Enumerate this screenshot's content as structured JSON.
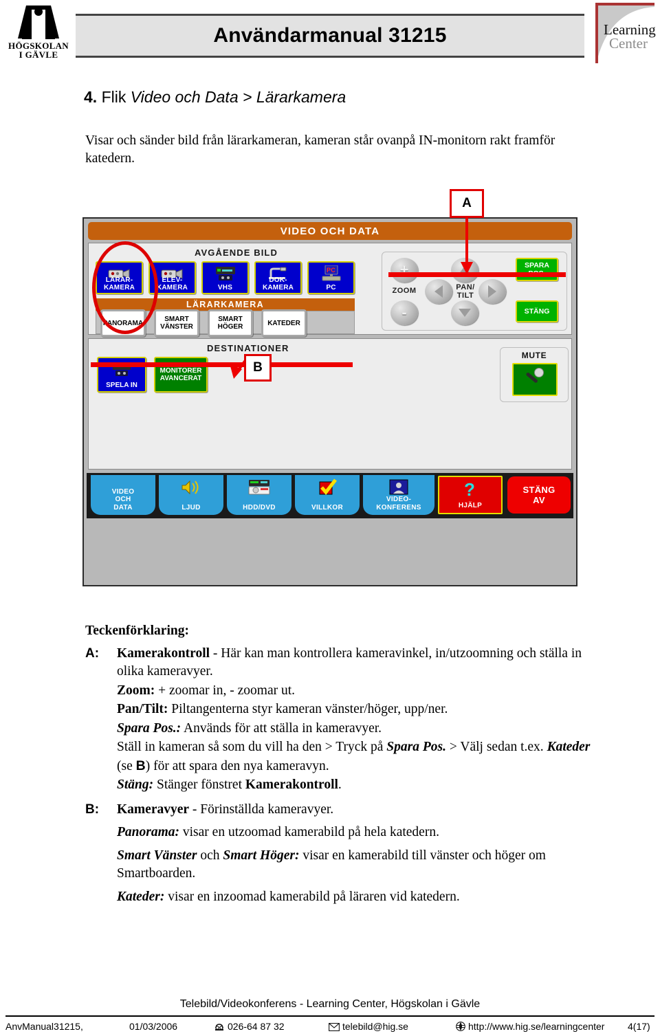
{
  "header": {
    "title": "Användarmanual 31215",
    "left_logo": {
      "name": "hogskolan-i-gavle-logo",
      "line1": "HÖGSKOLAN",
      "line2": "I GÄVLE"
    },
    "right_logo": {
      "name": "learning-center-logo",
      "line1": "Learning",
      "line2": "Center"
    }
  },
  "section": {
    "number": "4.",
    "prefix": "Flik",
    "italic_title": "Video och Data > Lärarkamera",
    "intro": "Visar och sänder bild från lärarkameran, kameran står ovanpå IN-monitorn rakt framför katedern."
  },
  "panel": {
    "title": "VIDEO OCH DATA",
    "outgoing_label": "AVGÅENDE BILD",
    "sources": [
      {
        "label_line1": "LÄRAR-",
        "label_line2": "KAMERA",
        "icon": "camcorder-icon",
        "selected": true
      },
      {
        "label_line1": "ELEV-",
        "label_line2": "KAMERA",
        "icon": "camcorder-icon",
        "selected": false
      },
      {
        "label_line1": "VHS",
        "label_line2": "",
        "icon": "vcr-icon",
        "selected": false
      },
      {
        "label_line1": "DOK-",
        "label_line2": "KAMERA",
        "icon": "document-camera-icon",
        "selected": false
      },
      {
        "label_line1": "PC",
        "label_line2": "",
        "icon": "pc-monitor-icon",
        "selected": false
      }
    ],
    "preset_group_title": "LÄRARKAMERA",
    "presets": [
      {
        "line1": "PANORAMA",
        "line2": ""
      },
      {
        "line1": "SMART",
        "line2": "VÄNSTER"
      },
      {
        "line1": "SMART",
        "line2": "HÖGER"
      },
      {
        "line1": "KATEDER",
        "line2": ""
      }
    ],
    "camera_control": {
      "zoom_label": "ZOOM",
      "zoom_in": "+",
      "zoom_out": "-",
      "pantilt_label_line1": "PAN/",
      "pantilt_label_line2": "TILT",
      "arrow_up": "arrow-up-icon",
      "arrow_down": "arrow-down-icon",
      "arrow_left": "arrow-left-icon",
      "arrow_right": "arrow-right-icon",
      "save_pos_line1": "SPARA",
      "save_pos_line2": "POS.",
      "close_label": "STÄNG"
    },
    "destinations_label": "DESTINATIONER",
    "destinations": [
      {
        "label": "SPELA IN",
        "icon": "vcr-icon",
        "color": "#0000cc"
      },
      {
        "label_line1": "MONITORER",
        "label_line2": "AVANCERAT",
        "icon": "",
        "color": "#008000"
      }
    ],
    "mute": {
      "label": "MUTE",
      "icon": "microphone-icon"
    },
    "nav": [
      {
        "line1": "VIDEO",
        "line2": "OCH",
        "line3": "DATA",
        "icon": ""
      },
      {
        "line1": "LJUD",
        "line2": "",
        "line3": "",
        "icon": "speaker-icon"
      },
      {
        "line1": "HDD/DVD",
        "line2": "",
        "line3": "",
        "icon": "recorder-icon"
      },
      {
        "line1": "VILLKOR",
        "line2": "",
        "line3": "",
        "icon": "checkmark-icon"
      },
      {
        "line1": "VIDEO-",
        "line2": "KONFERENS",
        "line3": "",
        "icon": "videoconference-icon"
      },
      {
        "line1": "HJÄLP",
        "line2": "",
        "line3": "",
        "icon": "question-mark-icon"
      },
      {
        "line1": "STÄNG",
        "line2": "AV",
        "line3": "",
        "icon": ""
      }
    ],
    "callouts": [
      {
        "label": "A"
      },
      {
        "label": "B"
      }
    ],
    "colors": {
      "orange_bar": "#c4600d",
      "source_blue": "#0000cc",
      "button_yellow_border": "#d4cf00",
      "green": "#00b200",
      "nav_blue": "#2f9fd8",
      "red": "#ee0000",
      "annotation_red": "#dd0000"
    }
  },
  "legend": {
    "heading": "Teckenförklaring:",
    "entries": [
      {
        "key": "A:",
        "lines": [
          {
            "bold_lead": "Kamerakontroll",
            "rest": " - Här kan man kontrollera kameravinkel, in/utzoomning och ställa in olika kameravyer."
          },
          {
            "bold_lead": "Zoom:",
            "rest": "  + zoomar in, - zoomar ut."
          },
          {
            "bold_lead": "Pan/Tilt:",
            "rest": " Piltangenterna styr kameran vänster/höger, upp/ner."
          },
          {
            "bold_italic_lead": "Spara Pos.:",
            "rest": " Används för att ställa in kameravyer."
          },
          {
            "plain": "Ställ in kameran så som du vill ha den > Tryck på ",
            "bi1": "Spara Pos.",
            "plain2": " >  Välj sedan t.ex. ",
            "bi2": "Kateder",
            "plain3": " (se ",
            "sans_b": "B",
            "plain4": ") för att spara den nya kameravyn."
          },
          {
            "bold_italic_lead": "Stäng:",
            "rest": " Stänger fönstret ",
            "bold_tail": "Kamerakontroll",
            "tail_period": "."
          }
        ]
      },
      {
        "key": "B:",
        "lines": [
          {
            "bold_lead": "Kameravyer",
            "rest": " - Förinställda kameravyer."
          },
          {
            "bold_italic_lead": "Panorama:",
            "rest": " visar en utzoomad kamerabild på hela katedern."
          },
          {
            "bi1": "Smart Vänster",
            "plain2": " och ",
            "bi2": "Smart Höger:",
            "plain3": " visar en kamerabild till vänster och höger om Smartboarden."
          },
          {
            "bold_italic_lead": "Kateder:",
            "rest": " visar en inzoomad kamerabild på läraren vid katedern."
          }
        ]
      }
    ]
  },
  "footer": {
    "title": "Telebild/Videokonferens - Learning Center, Högskolan i Gävle",
    "doc_id": "AnvManual31215,",
    "date": "01/03/2006",
    "phone": "026-64 87 32",
    "email": "telebild@hig.se",
    "url": "http://www.hig.se/learningcenter",
    "page": "4(17)",
    "icons": {
      "phone": "telephone-icon",
      "email": "envelope-icon",
      "web": "globe-icon"
    }
  }
}
